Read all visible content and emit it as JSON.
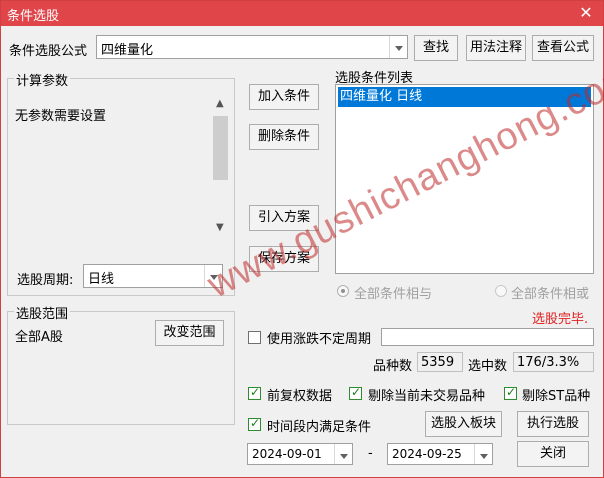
{
  "window": {
    "title": "条件选股",
    "close_glyph": "✕"
  },
  "formula_row": {
    "label": "条件选股公式",
    "value": "四维量化",
    "find_label": "查找",
    "usage_label": "用法注释",
    "view_label": "查看公式"
  },
  "params_group": {
    "caption": "计算参数",
    "text": "无参数需要设置",
    "period_label": "选股周期:",
    "period_value": "日线"
  },
  "actions": {
    "add": "加入条件",
    "delete": "删除条件",
    "import": "引入方案",
    "save": "保存方案"
  },
  "condition_list": {
    "caption": "选股条件列表",
    "items": [
      "四维量化  日线"
    ]
  },
  "logic": {
    "and_label": "全部条件相与",
    "or_label": "全部条件相或"
  },
  "status": {
    "text": "选股完毕.",
    "color": "#e02020"
  },
  "range_group": {
    "caption": "选股范围",
    "value": "全部A股",
    "change_label": "改变范围"
  },
  "options": {
    "floating_period": "使用涨跌不定周期",
    "stock_count_label": "品种数",
    "stock_count": "5359",
    "selected_label": "选中数",
    "selected_value": "176/3.3%",
    "pre_adjust": "前复权数据",
    "remove_untraded": "剔除当前未交易品种",
    "remove_st": "剔除ST品种",
    "time_range": "时间段内满足条件"
  },
  "dates": {
    "start": "2024-09-01",
    "separator": "-",
    "end": "2024-09-25"
  },
  "bottom_buttons": {
    "to_block": "选股入板块",
    "execute": "执行选股",
    "close": "关闭"
  },
  "watermark": "www.gushichanghong.com"
}
